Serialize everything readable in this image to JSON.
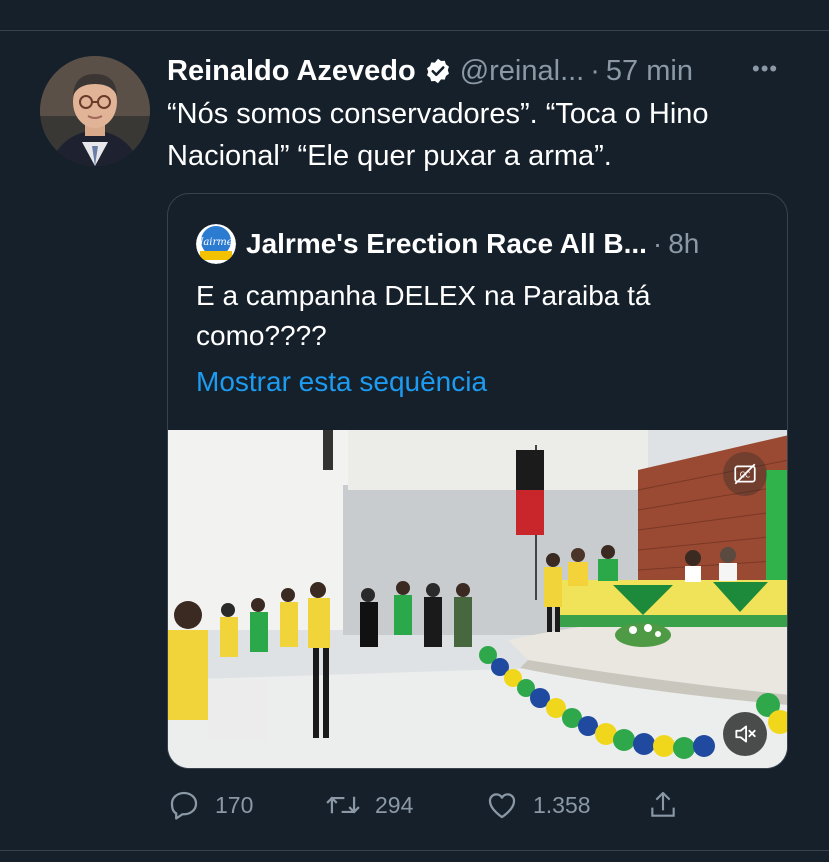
{
  "tweet": {
    "author_name": "Reinaldo Azevedo",
    "handle": "@reinal...",
    "separator": "·",
    "time": "57 min",
    "more": "•••",
    "text": "“Nós somos conservadores”. “Toca o Hino Nacional” “Ele quer puxar a arma”."
  },
  "quote": {
    "author_name": "Jalrme's Erection Race All B...",
    "separator": "·",
    "time": "8h",
    "text": "E a campanha DELEX na Paraiba tá como????",
    "show_thread": "Mostrar esta sequência",
    "avatar_text": "Jairme"
  },
  "actions": {
    "replies": "170",
    "retweets": "294",
    "likes": "1.358"
  },
  "colors": {
    "background": "#15202b",
    "link": "#1d9bf0",
    "muted": "#8b98a5",
    "border": "#38444d"
  }
}
